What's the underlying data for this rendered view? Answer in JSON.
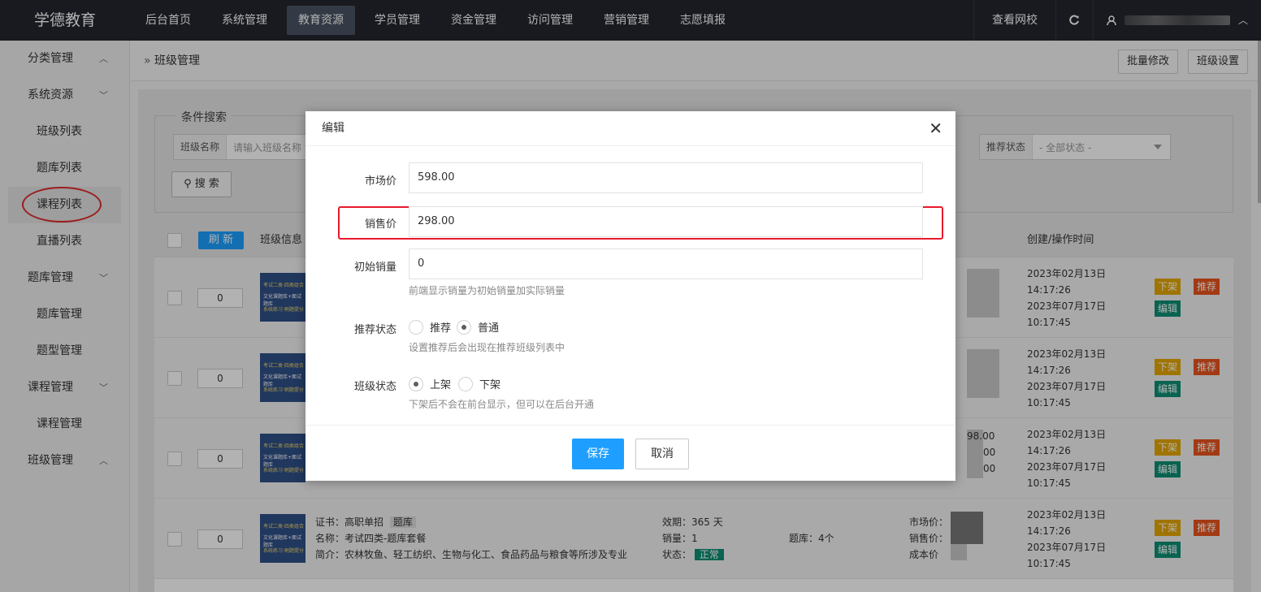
{
  "app": {
    "logo": "学德教育"
  },
  "topnav": {
    "items": [
      "后台首页",
      "系统管理",
      "教育资源",
      "学员管理",
      "资金管理",
      "访问管理",
      "营销管理",
      "志愿填报"
    ],
    "active_index": 2,
    "view_site": "查看网校",
    "refresh_icon": "refresh-icon",
    "user_icon": "user-icon"
  },
  "sidebar": {
    "groups": [
      {
        "label": "分类管理",
        "expanded": false
      },
      {
        "label": "系统资源",
        "expanded": true,
        "items": [
          "班级列表",
          "题库列表",
          "课程列表",
          "直播列表"
        ]
      },
      {
        "label": "题库管理",
        "expanded": true,
        "items": [
          "题库管理",
          "题型管理"
        ]
      },
      {
        "label": "课程管理",
        "expanded": true,
        "items": [
          "课程管理"
        ]
      },
      {
        "label": "班级管理",
        "expanded": false
      }
    ],
    "active_item": "课程列表"
  },
  "header": {
    "breadcrumb": "班级管理",
    "buttons": [
      "批量修改",
      "班级设置"
    ]
  },
  "search": {
    "legend": "条件搜索",
    "class_name_label": "班级名称",
    "class_name_placeholder": "请输入班级名称",
    "recommend_label": "推荐状态",
    "recommend_value": "- 全部状态 -",
    "search_button": "搜 索"
  },
  "table": {
    "refresh_button": "刷 新",
    "col_class_info": "班级信息",
    "col_time": "创建/操作时间",
    "rows": [
      {
        "sort": "0",
        "created_date": "2023年02月13日",
        "created_time": "14:17:26",
        "updated_date": "2023年07月17日",
        "updated_time": "10:17:45",
        "actions": [
          "下架",
          "推荐",
          "编辑"
        ]
      },
      {
        "sort": "0",
        "created_date": "2023年02月13日",
        "created_time": "14:17:26",
        "updated_date": "2023年07月17日",
        "updated_time": "10:17:45",
        "actions": [
          "下架",
          "推荐",
          "编辑"
        ]
      },
      {
        "sort": "0",
        "created_date": "2023年02月13日",
        "created_time": "14:17:26",
        "updated_date": "2023年07月17日",
        "updated_time": "10:17:45",
        "actions": [
          "下架",
          "推荐",
          "编辑"
        ],
        "price_frag1": "98.00",
        "price_frag2": "00",
        "price_frag3": "00"
      },
      {
        "sort": "0",
        "cert": "证书：高职单招",
        "cert_tag": "题库",
        "name": "名称：考试四类-题库套餐",
        "intro": "简介：农林牧鱼、轻工纺织、生物与化工、食品药品与粮食等所涉及专业",
        "validity": "效期：365 天",
        "sales": "销量：1",
        "status_label": "状态：",
        "status_value": "正常",
        "bank_count": "题库：4个",
        "market_price_label": "市场价：",
        "sale_price_label": "销售价：",
        "cost_label": "成本价",
        "created_date": "2023年02月13日",
        "created_time": "14:17:26",
        "updated_date": "2023年07月17日",
        "updated_time": "10:17:45",
        "actions": [
          "下架",
          "推荐",
          "编辑"
        ]
      }
    ],
    "thumb_line1": "考试二类·四类组合",
    "thumb_line2": "文化课题库+面试题库",
    "thumb_line3": "系统练习·刷题提分"
  },
  "modal": {
    "title": "编辑",
    "close_icon": "close-icon",
    "market_price_label": "市场价",
    "market_price_value": "598.00",
    "sale_price_label": "销售价",
    "sale_price_value": "298.00",
    "initial_sales_label": "初始销量",
    "initial_sales_value": "0",
    "initial_sales_hint": "前端显示销量为初始销量加实际销量",
    "recommend_label": "推荐状态",
    "recommend_options": [
      "推荐",
      "普通"
    ],
    "recommend_selected": "普通",
    "recommend_hint": "设置推荐后会出现在推荐班级列表中",
    "class_status_label": "班级状态",
    "class_status_options": [
      "上架",
      "下架"
    ],
    "class_status_selected": "上架",
    "class_status_hint": "下架后不会在前台显示，但可以在后台开通",
    "save_button": "保存",
    "cancel_button": "取消"
  },
  "colors": {
    "primary": "#1e9fff",
    "highlight": "#e8192c",
    "topbar": "#23262e",
    "tag_yellow": "#e6a700",
    "tag_red": "#e8531e",
    "tag_green": "#0e8e74"
  }
}
